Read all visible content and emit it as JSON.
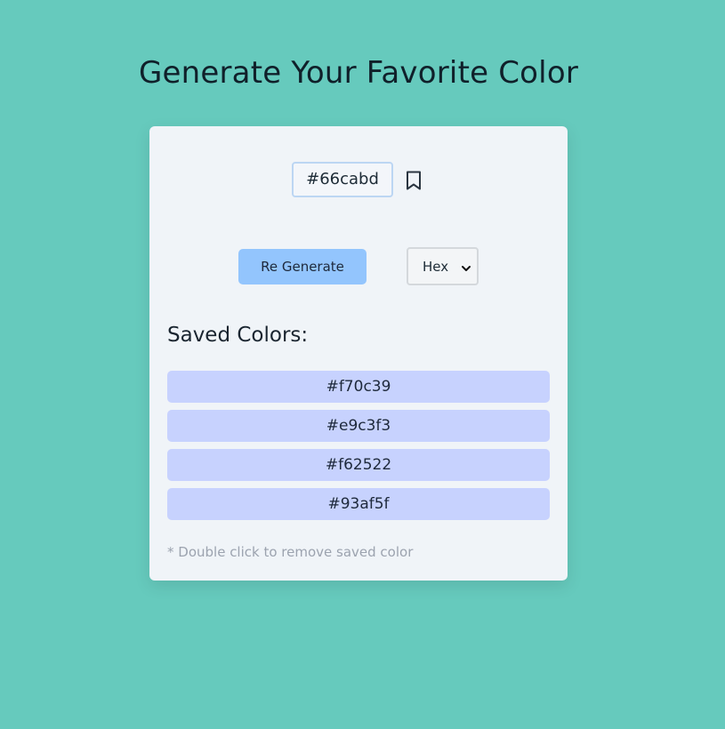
{
  "page": {
    "title": "Generate Your Favorite Color",
    "background_color": "#66cabd"
  },
  "generator": {
    "current_value": "#66cabd",
    "bookmark_icon": "bookmark-icon",
    "regenerate_label": "Re Generate",
    "regenerate_color": "#93c5fd",
    "format_selected": "Hex"
  },
  "saved": {
    "heading": "Saved Colors:",
    "items": [
      {
        "label": "#f70c39"
      },
      {
        "label": "#e9c3f3"
      },
      {
        "label": "#f62522"
      },
      {
        "label": "#93af5f"
      }
    ],
    "item_color": "#c7d2fe",
    "hint": "* Double click to remove saved color"
  }
}
